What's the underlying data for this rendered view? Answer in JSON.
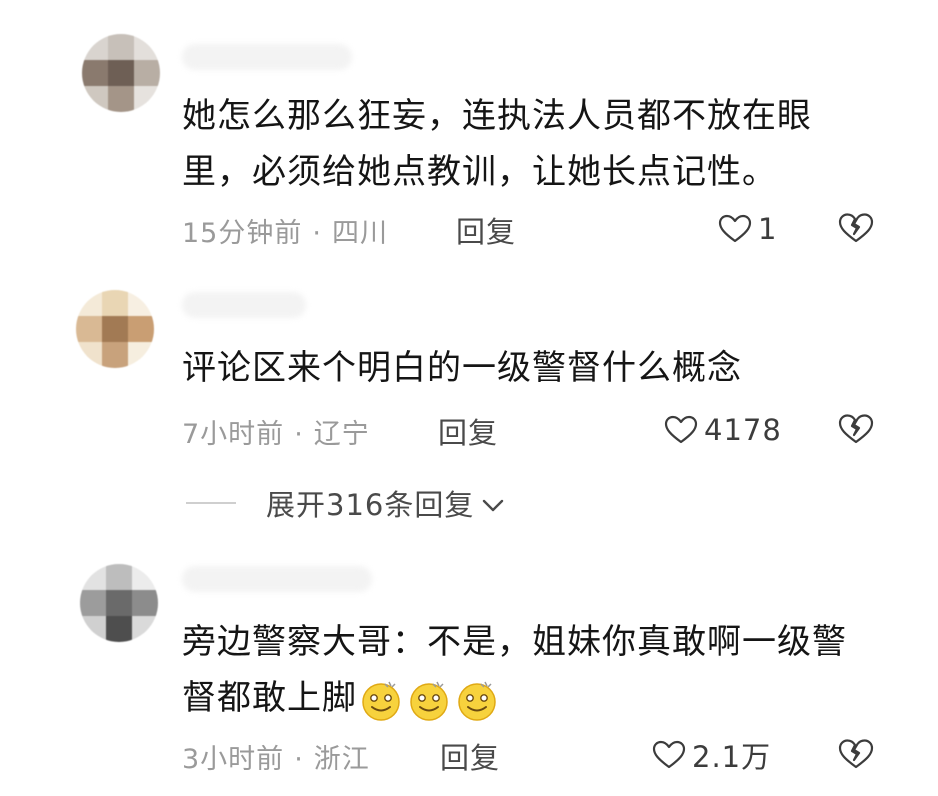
{
  "comments": [
    {
      "text": "她怎么那么狂妄，连执法人员都不放在眼里，必须给她点教训，让她长点记性。",
      "time": "15分钟前",
      "region": "四川",
      "reply_label": "回复",
      "likes": "1"
    },
    {
      "text": "评论区来个明白的一级警督什么概念",
      "time": "7小时前",
      "region": "辽宁",
      "reply_label": "回复",
      "likes": "4178",
      "expand_label": "展开316条回复"
    },
    {
      "text": "旁边警察大哥：不是，姐妹你真敢啊一级警督都敢上脚",
      "time": "3小时前",
      "region": "浙江",
      "reply_label": "回复",
      "likes": "2.1万",
      "emoji": [
        "dizzy-smile-emoji",
        "dizzy-smile-emoji",
        "dizzy-smile-emoji"
      ]
    }
  ],
  "separator": "·",
  "colors": {
    "meta_text": "#9a9a9a",
    "body_text": "#151515",
    "icon_stroke": "#3c3c3c"
  }
}
